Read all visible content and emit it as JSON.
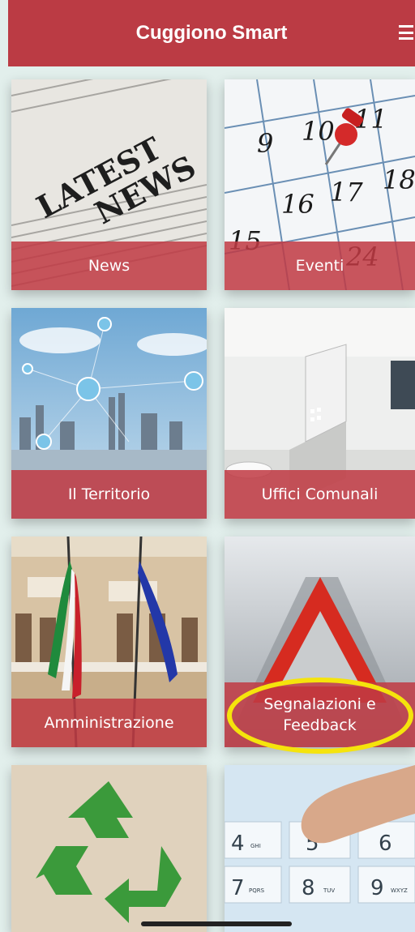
{
  "header": {
    "title": "Cuggiono Smart",
    "menu_icon": "hamburger-menu-icon"
  },
  "tiles": [
    {
      "label": "News",
      "image": "latest-news-newspaper"
    },
    {
      "label": "Eventi",
      "image": "calendar-with-pin"
    },
    {
      "label": "Il Territorio",
      "image": "connected-city-skyline"
    },
    {
      "label": "Uffici Comunali",
      "image": "office-desk"
    },
    {
      "label": "Amministrazione",
      "image": "town-hall-flags"
    },
    {
      "label": "Segnalazioni e\nFeedback",
      "image": "warning-triangle-road"
    },
    {
      "label": "",
      "image": "recycle-symbol"
    },
    {
      "label": "",
      "image": "phone-keypad-finger"
    }
  ],
  "newspaper_text": {
    "line1": "LATEST",
    "line2": "NEWS"
  },
  "calendar_numbers": [
    "9",
    "10",
    "11",
    "16",
    "17",
    "18",
    "15",
    "24"
  ],
  "keypad": [
    {
      "digit": "4",
      "letters": "GHI"
    },
    {
      "digit": "5",
      "letters": ""
    },
    {
      "digit": "6",
      "letters": ""
    },
    {
      "digit": "7",
      "letters": "PQRS"
    },
    {
      "digit": "8",
      "letters": "TUV"
    },
    {
      "digit": "9",
      "letters": "WXYZ"
    }
  ],
  "colors": {
    "accent": "#bb3b44",
    "highlight": "#f5e40c",
    "background": "#e2efec"
  }
}
